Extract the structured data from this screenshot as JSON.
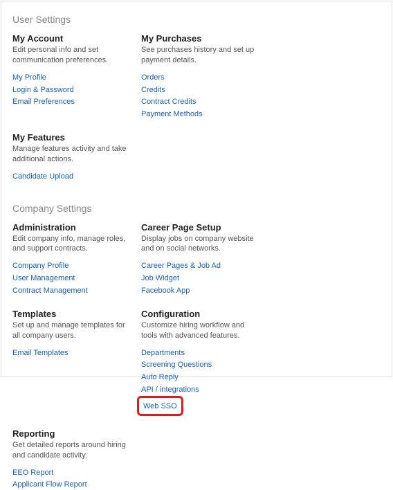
{
  "sections": {
    "user": {
      "title": "User Settings",
      "blocks": [
        {
          "heading": "My Account",
          "desc": "Edit personal info and set communication preferences.",
          "links": [
            "My Profile",
            "Login & Password",
            "Email Preferences"
          ]
        },
        {
          "heading": "My Purchases",
          "desc": "See purchases history and set up payment details.",
          "links": [
            "Orders",
            "Credits",
            "Contract Credits",
            "Payment Methods"
          ]
        },
        {
          "heading": "My Features",
          "desc": "Manage features activity and take additional actions.",
          "links": [
            "Candidate Upload"
          ]
        }
      ]
    },
    "company": {
      "title": "Company Settings",
      "blocks": [
        {
          "heading": "Administration",
          "desc": "Edit company info, manage roles, and support contracts.",
          "links": [
            "Company Profile",
            "User Management",
            "Contract Management"
          ]
        },
        {
          "heading": "Career Page Setup",
          "desc": "Display jobs on company website and on social networks.",
          "links": [
            "Career Pages & Job Ad",
            "Job Widget",
            "Facebook App"
          ]
        },
        {
          "heading": "Templates",
          "desc": "Set up and manage templates for all company users.",
          "links": [
            "Email Templates"
          ]
        },
        {
          "heading": "Configuration",
          "desc": "Customize hiring workflow and tools with advanced features.",
          "links": [
            "Departments",
            "Screening Questions",
            "Auto Reply",
            "API / integrations"
          ],
          "highlighted_link": "Web SSO"
        },
        {
          "heading": "Reporting",
          "desc": "Get detailed reports around hiring and candidate activity.",
          "links": [
            "EEO Report",
            "Applicant Flow Report"
          ]
        }
      ]
    }
  }
}
